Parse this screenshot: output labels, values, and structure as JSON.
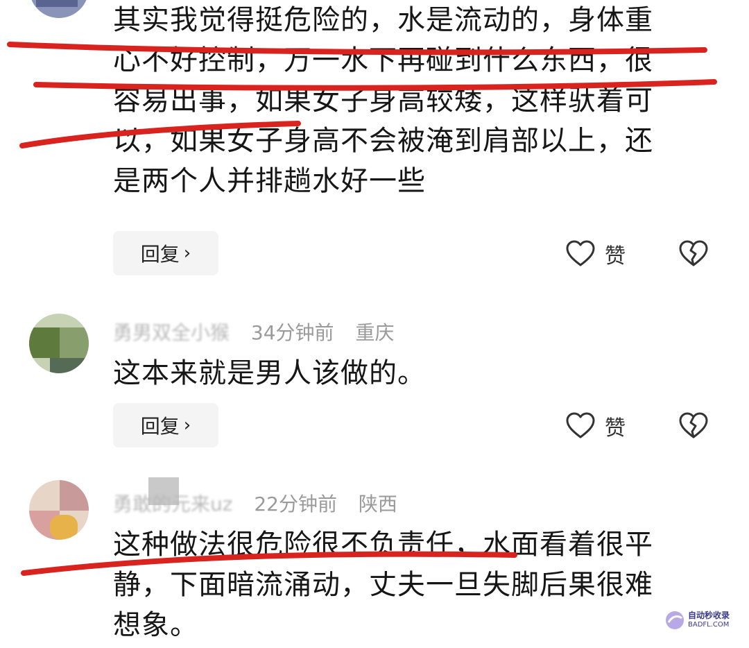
{
  "comments": [
    {
      "username": "",
      "time": "",
      "location": "",
      "text": "其实我觉得挺危险的，水是流动的，身体重\n心不好控制，万一水下再碰到什么东西，很\n容易出事，如果女子身高较矮，这样驮着可\n以，如果女子身高不会被淹到肩部以上，还\n是两个人并排趟水好一些",
      "reply_label": "回复",
      "like_label": "赞"
    },
    {
      "username": "勇男双全小猴",
      "time": "34分钟前",
      "location": "重庆",
      "text": "这本来就是男人该做的。",
      "reply_label": "回复",
      "like_label": "赞"
    },
    {
      "username": "勇敢的元来uz",
      "time": "22分钟前",
      "location": "陕西",
      "text": "这种做法很危险很不负责任，水面看着很平\n静，下面暗流涌动，丈夫一旦失脚后果很难\n想象。",
      "reply_label": "",
      "like_label": ""
    }
  ],
  "icons": {
    "like": "heart-outline-icon",
    "dislike": "broken-heart-icon",
    "reply_chevron": "chevron-right-icon"
  },
  "reply_chevron": "›",
  "watermark": {
    "line1": "自动秒收录",
    "line2": "BADFL.COM"
  },
  "colors": {
    "underline": "#d8231f",
    "meta": "#9a9a9a",
    "reply_bg": "#f4f4f4",
    "text": "#161616"
  }
}
